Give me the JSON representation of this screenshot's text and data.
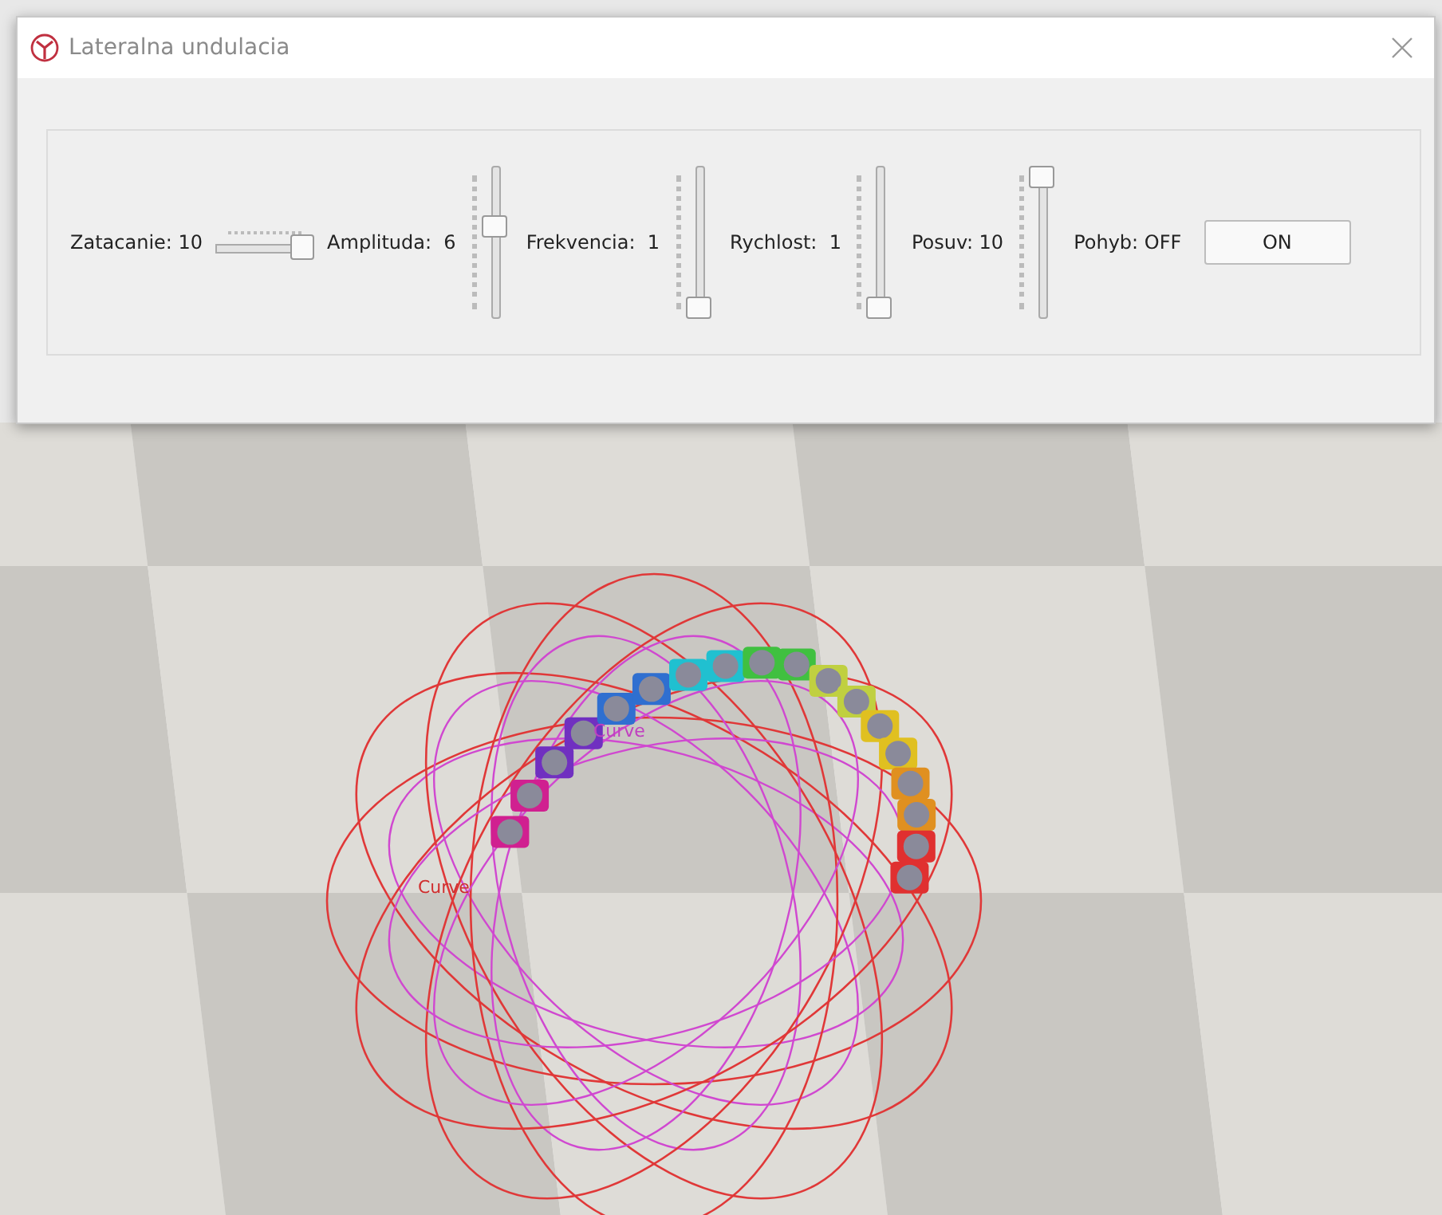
{
  "window": {
    "title": "Lateralna undulacia"
  },
  "controls": [
    {
      "kind": "hslider",
      "label": "Zatacanie: 10",
      "level": 1
    },
    {
      "kind": "vslider",
      "label": "Amplituda:  6",
      "level": 0.62
    },
    {
      "kind": "vslider",
      "label": "Frekvencia:  1",
      "level": 0
    },
    {
      "kind": "vslider",
      "label": "Rychlost:  1",
      "level": 0
    },
    {
      "kind": "vslider",
      "label": "Posuv: 10",
      "level": 1
    },
    {
      "kind": "button",
      "label": "Pohyb: OFF",
      "button": "ON"
    }
  ],
  "scene": {
    "labels": [
      {
        "text": "Curve",
        "color": "#c040c0"
      },
      {
        "text": "Curve",
        "color": "#d03030"
      }
    ]
  }
}
